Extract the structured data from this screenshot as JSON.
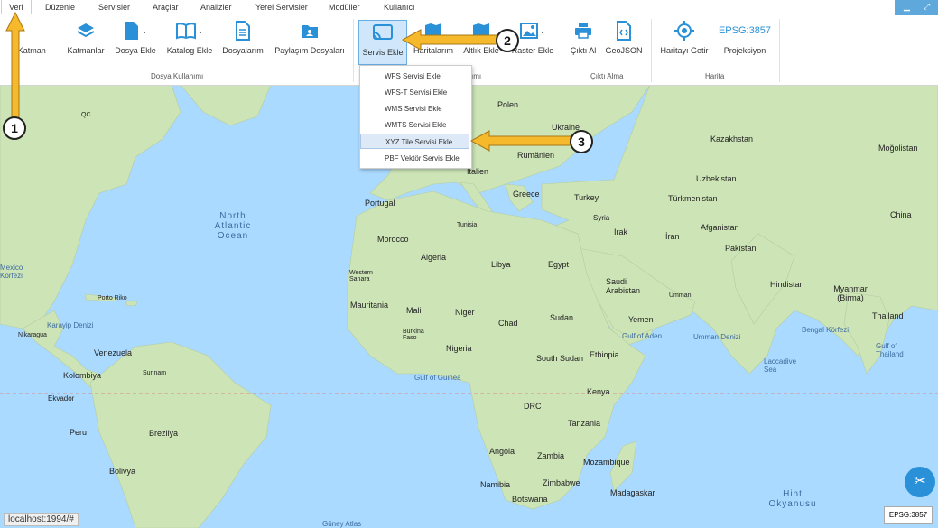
{
  "menu": [
    "Veri",
    "Düzenle",
    "Servisler",
    "Araçlar",
    "Analizler",
    "Yerel Servisler",
    "Modüller",
    "Kullanıcı"
  ],
  "toolbar": {
    "yeni_katman": "i Katman",
    "katmanlar": "Katmanlar",
    "dosya_ekle": "Dosya Ekle",
    "katalog_ekle": "Katalog Ekle",
    "dosyalarim": "Dosyalarım",
    "paylasim_dosyalari": "Paylaşım Dosyaları",
    "servis_ekle": "Servis Ekle",
    "haritalarim": "Haritalarım",
    "altlik_ekle": "Altlık Ekle",
    "raster_ekle": "Raster Ekle",
    "cikti_al": "Çıktı Al",
    "geojson": "GeoJSON",
    "haritayi_getir": "Haritayı Getir",
    "epsg": "EPSG:3857",
    "projeksiyon": "Projeksiyon"
  },
  "groups": {
    "dosya_kullanimi": "Dosya Kullanımı",
    "servis_group_suffix": "ımı",
    "cikti_alma": "Çıktı Alma",
    "harita": "Harita"
  },
  "dropdown": [
    "WFS Servisi Ekle",
    "WFS-T Servisi Ekle",
    "WMS Servisi Ekle",
    "WMTS Servisi Ekle",
    "XYZ Tile Servisi Ekle",
    "PBF Vektör Servis Ekle"
  ],
  "callouts": [
    "1",
    "2",
    "3"
  ],
  "map_labels": {
    "poland": "Polen",
    "ukraine": "Ukraine",
    "romania": "Rumänien",
    "greece": "Greece",
    "italy": "Italien",
    "turkey": "Turkey",
    "portugal": "Portugal",
    "tunisia": "Tunisia",
    "morocco": "Morocco",
    "algeria": "Algeria",
    "libya": "Libya",
    "egypt": "Egypt",
    "western_sahara": "Western Sahara",
    "mauritania": "Mauritania",
    "mali": "Mali",
    "niger": "Niger",
    "chad": "Chad",
    "sudan": "Sudan",
    "burkina": "Burkina Faso",
    "nigeria": "Nigeria",
    "ethiopia": "Ethiopia",
    "south_sudan": "South Sudan",
    "kenya": "Kenya",
    "drc": "DRC",
    "tanzania": "Tanzania",
    "angola": "Angola",
    "zambia": "Zambia",
    "mozambique": "Mozambique",
    "namibia": "Namibia",
    "zimbabwe": "Zimbabwe",
    "botswana": "Botswana",
    "madagascar": "Madagaskar",
    "kazakhstan": "Kazakhstan",
    "mongolia": "Moğolistan",
    "uzbekistan": "Uzbekistan",
    "turkmenistan": "Türkmenistan",
    "syria": "Syria",
    "iraq": "Irak",
    "iran": "İran",
    "afghanistan": "Afganistan",
    "pakistan": "Pakistan",
    "china": "China",
    "saudi": "Saudi Arabistan",
    "yemen": "Yemen",
    "oman": "Umman",
    "india": "Hindistan",
    "myanmar": "Myanmar (Birma)",
    "thailand": "Thailand",
    "venezuela": "Venezuela",
    "colombia": "Kolombiya",
    "suriname": "Surinam",
    "ecuador": "Ekvador",
    "peru": "Peru",
    "brazil": "Brezilya",
    "bolivia": "Bolivya",
    "puerto": "Porto Riko",
    "nicaragua": "Nikaragua",
    "qc": "QC",
    "gulf_guinea": "Gulf of Guinea",
    "gulf_aden": "Gulf of Aden",
    "bengal": "Bengal Körfezi",
    "laccadive": "Laccadive Sea",
    "gulf_thailand": "Gulf of Thailand",
    "karayip": "Karayip Denizi",
    "gulf_mexico": "Mexico Körfezi",
    "north_atlantic": "North Atlantic Ocean",
    "indian_ocean": "Hint Okyanusu",
    "arabian": "Umman Denizi",
    "guney_atlas": "Güney Atlas"
  },
  "status_url": "localhost:1994/#",
  "epsg_box": "EPSG:3857",
  "colors": {
    "accent": "#2a91d8",
    "ocean": "#aadaff",
    "land": "#cde4b7",
    "arrow": "#f6b92c"
  }
}
